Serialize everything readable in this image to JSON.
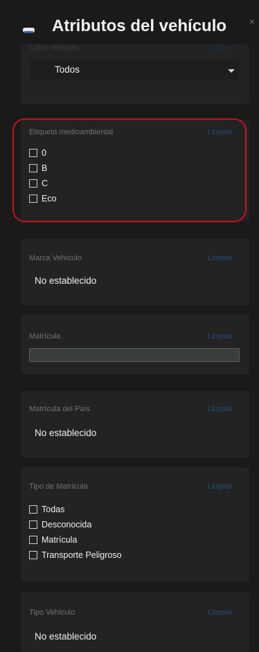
{
  "header": {
    "title": "Atributos del vehículo",
    "close": "×"
  },
  "color": {
    "label": "Color Vehículo",
    "clear": "Limpiar",
    "selected": "Todos"
  },
  "eco_label": {
    "label": "Etiqueta medioambiental",
    "clear": "Limpiar",
    "options": [
      "0",
      "B",
      "C",
      "Eco"
    ]
  },
  "brand": {
    "label": "Marca Vehículo",
    "clear": "Limpiar",
    "value": "No establecido"
  },
  "plate": {
    "label": "Matrícula",
    "clear": "Limpiar",
    "value": ""
  },
  "plate_country": {
    "label": "Matrícula del País",
    "clear": "Limpiar",
    "value": "No establecido"
  },
  "plate_type": {
    "label": "Tipo de Matrícula",
    "clear": "Limpiar",
    "options": [
      "Todas",
      "Desconocida",
      "Matrícula",
      "Transporte Peligroso"
    ]
  },
  "vehicle_type": {
    "label": "Tipo Vehículo",
    "clear": "Limpiar",
    "value": "No establecido"
  },
  "colors": {
    "background": "#1a1a1a",
    "card": "#232323",
    "label": "#6f7378",
    "clear_link": "#234d77",
    "highlight": "#c8141c"
  }
}
